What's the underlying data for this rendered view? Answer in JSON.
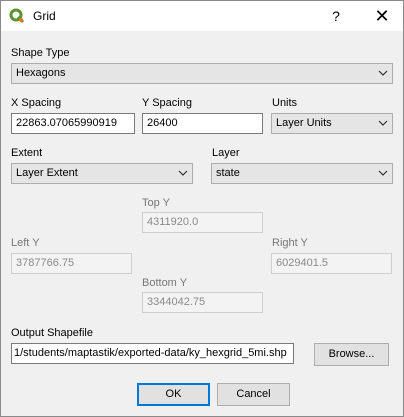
{
  "window": {
    "title": "Grid",
    "help_glyph": "?",
    "close_glyph": "✕"
  },
  "shape_type": {
    "label": "Shape Type",
    "value": "Hexagons"
  },
  "x_spacing": {
    "label": "X Spacing",
    "value": "22863.07065990919"
  },
  "y_spacing": {
    "label": "Y Spacing",
    "value": "26400"
  },
  "units": {
    "label": "Units",
    "value": "Layer Units"
  },
  "extent": {
    "label": "Extent",
    "value": "Layer Extent"
  },
  "layer": {
    "label": "Layer",
    "value": "state"
  },
  "top_y": {
    "label": "Top Y",
    "value": "4311920.0"
  },
  "left_y": {
    "label": "Left Y",
    "value": "3787766.75"
  },
  "right_y": {
    "label": "Right Y",
    "value": "6029401.5"
  },
  "bottom_y": {
    "label": "Bottom Y",
    "value": "3344042.75"
  },
  "output": {
    "label": "Output Shapefile",
    "value": "1/students/maptastik/exported-data/ky_hexgrid_5mi.shp",
    "browse_label": "Browse..."
  },
  "buttons": {
    "ok": "OK",
    "cancel": "Cancel"
  },
  "colors": {
    "qgis_green": "#589632",
    "qgis_yellow": "#ee7913",
    "focus_blue": "#0078d7"
  }
}
